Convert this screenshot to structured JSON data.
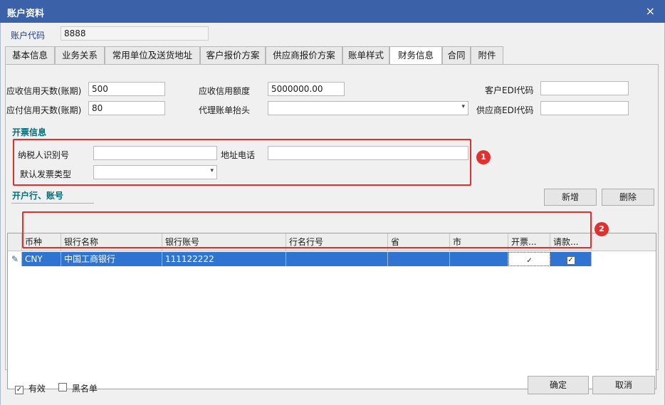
{
  "window": {
    "title": "账户资料",
    "close_glyph": "×"
  },
  "account": {
    "code_label": "账户代码",
    "code_value": "8888"
  },
  "tabs": [
    {
      "label": "基本信息"
    },
    {
      "label": "业务关系"
    },
    {
      "label": "常用单位及送货地址"
    },
    {
      "label": "客户报价方案"
    },
    {
      "label": "供应商报价方案"
    },
    {
      "label": "账单样式"
    },
    {
      "label": "财务信息"
    },
    {
      "label": "合同"
    },
    {
      "label": "附件"
    }
  ],
  "active_tab": "财务信息",
  "finance": {
    "ar_days_label": "应收信用天数(账期)",
    "ar_days_value": "500",
    "ar_limit_label": "应收信用额度",
    "ar_limit_value": "5000000.00",
    "customer_edi_label": "客户EDI代码",
    "customer_edi_value": "",
    "ap_days_label": "应付信用天数(账期)",
    "ap_days_value": "80",
    "agent_bill_label": "代理账单抬头",
    "agent_bill_value": "",
    "supplier_edi_label": "供应商EDI代码",
    "supplier_edi_value": ""
  },
  "invoice": {
    "section_title": "开票信息",
    "taxpayer_id_label": "纳税人识别号",
    "taxpayer_id_value": "",
    "address_phone_label": "地址电话",
    "address_phone_value": "",
    "invoice_type_label": "默认发票类型",
    "invoice_type_value": "",
    "badge": "1"
  },
  "bank": {
    "section_title": "开户行、账号",
    "add_label": "新增",
    "delete_label": "删除",
    "badge": "2",
    "columns": [
      "币种",
      "银行名称",
      "银行账号",
      "行名行号",
      "省",
      "市",
      "开票...",
      "请款..."
    ],
    "rows": [
      {
        "currency": "CNY",
        "bank_name": "中国工商银行",
        "account_no": "111122222",
        "bank_code": "",
        "province": "",
        "city": "",
        "invoice_flag": "✓",
        "payment_flag": "✓"
      }
    ]
  },
  "footer": {
    "valid_label": "有效",
    "valid_checked": "✓",
    "blacklist_label": "黑名单",
    "ok_label": "确定",
    "cancel_label": "取消"
  },
  "icons": {
    "edit_row": "✎",
    "dropdown": "▾"
  },
  "colors": {
    "titlebar": "#3b62a8",
    "selection": "#2f74d0",
    "highlight_box": "#e0312f",
    "section_title": "#00707a"
  }
}
